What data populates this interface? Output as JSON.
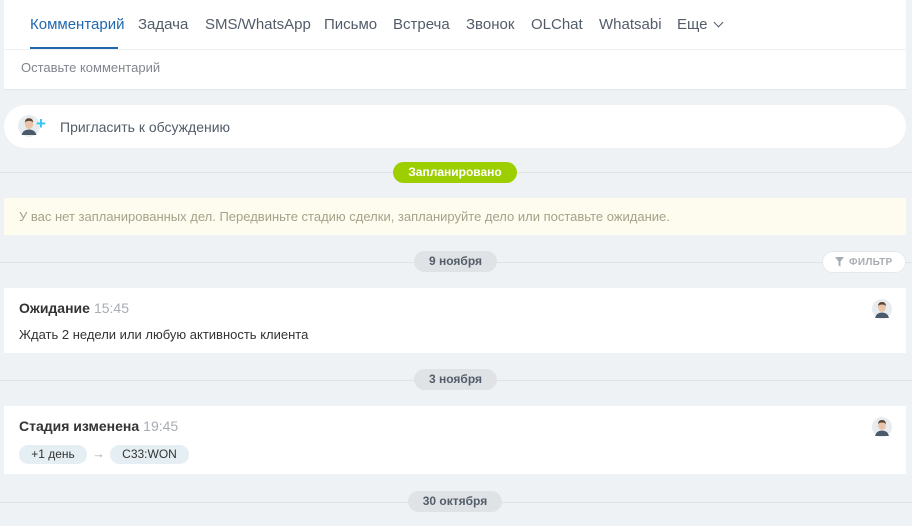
{
  "editor": {
    "tabs": [
      {
        "label": "Комментарий",
        "active": true
      },
      {
        "label": "Задача"
      },
      {
        "label": "SMS/WhatsApp"
      },
      {
        "label": "Письмо"
      },
      {
        "label": "Встреча"
      },
      {
        "label": "Звонок"
      },
      {
        "label": "OLChat"
      },
      {
        "label": "Whatsabi"
      },
      {
        "label": "Еще"
      }
    ],
    "placeholder": "Оставьте комментарий"
  },
  "invite": {
    "label": "Пригласить к обсуждению",
    "icon": "user-add-icon"
  },
  "planned": {
    "badge": "Запланировано",
    "empty_text": "У вас нет запланированных дел. Передвиньте стадию сделки, запланируйте дело или поставьте ожидание."
  },
  "filter": {
    "label": "ФИЛЬТР",
    "icon": "funnel-icon"
  },
  "history": [
    {
      "date": "9 ноября",
      "items": [
        {
          "title": "Ожидание",
          "time": "15:45",
          "text": "Ждать 2 недели или любую активность клиента"
        }
      ]
    },
    {
      "date": "3 ноября",
      "items": [
        {
          "title": "Стадия изменена",
          "time": "19:45",
          "from": "+1 день",
          "to": "C33:WON"
        }
      ]
    },
    {
      "date": "30 октября",
      "items": []
    }
  ],
  "colors": {
    "accent": "#2067b0",
    "planned_badge": "#9dcf00",
    "background": "#eef2f4",
    "notice_bg": "#fefcee"
  }
}
